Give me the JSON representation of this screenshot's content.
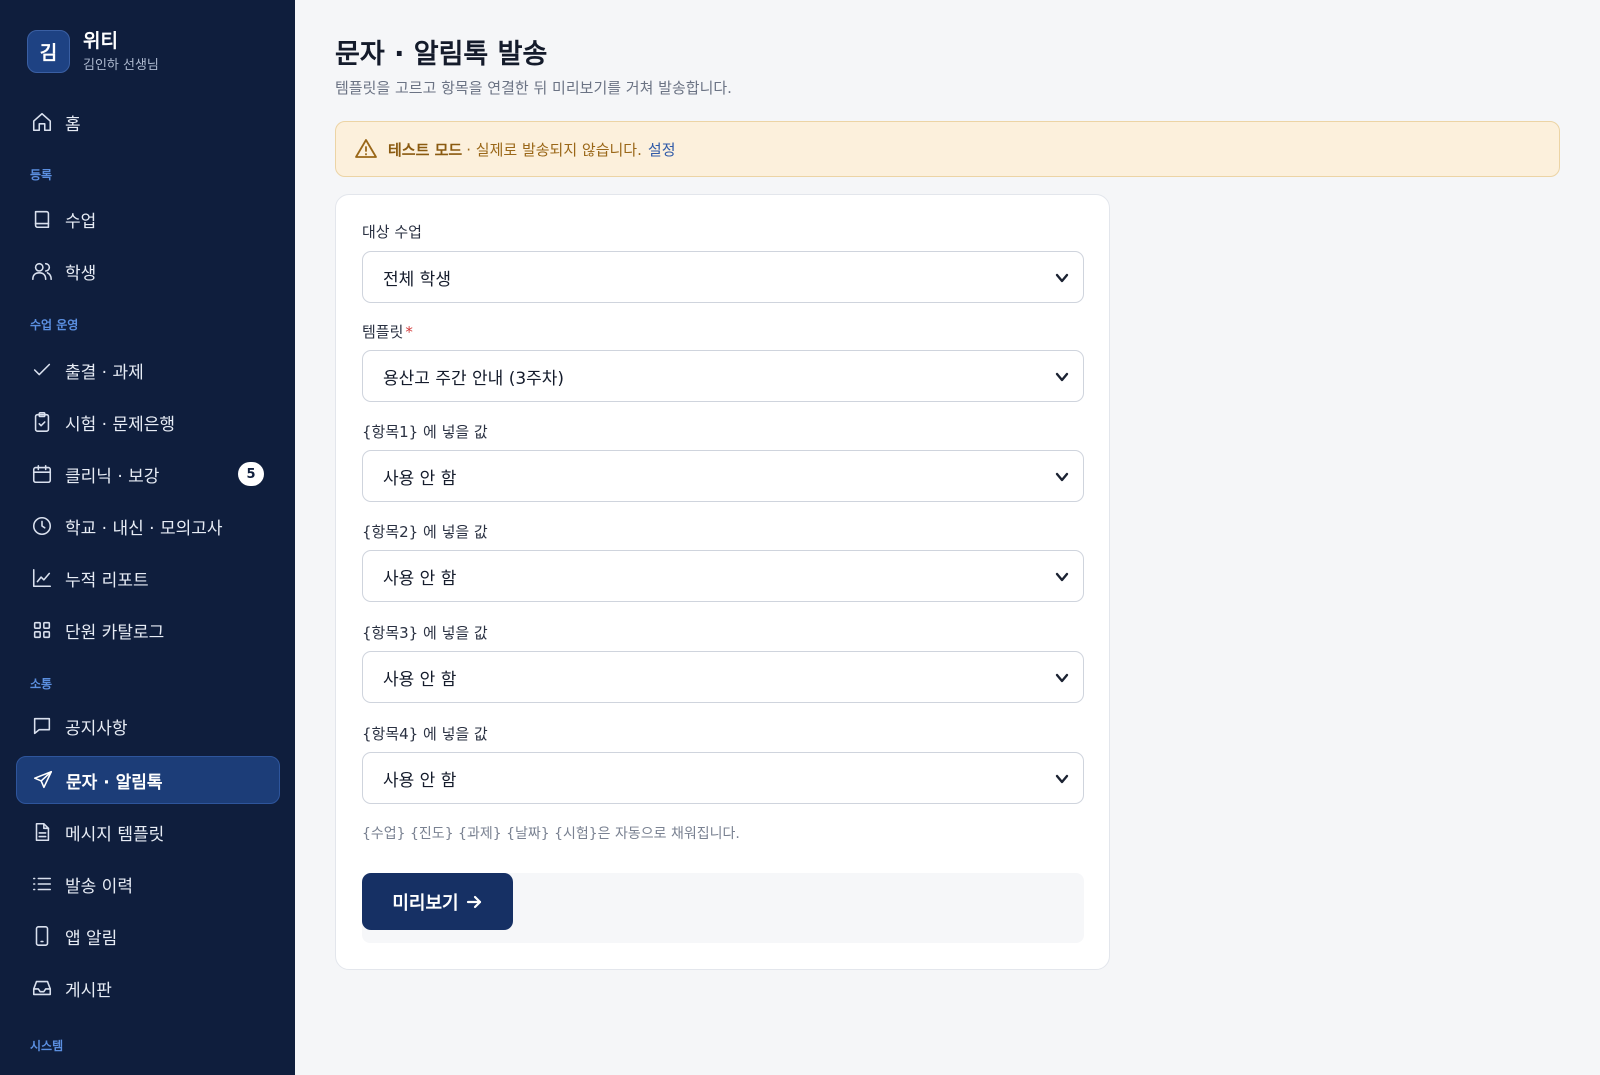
{
  "brand": {
    "avatar_letter": "김",
    "name": "위티",
    "user": "김인하 선생님"
  },
  "sidebar": {
    "home": {
      "label": "홈",
      "icon": "home-icon"
    },
    "sections": {
      "register": "등록",
      "operations": "수업 운영",
      "communication": "소통",
      "system": "시스템"
    },
    "register_items": [
      {
        "label": "수업",
        "icon": "book-icon"
      },
      {
        "label": "학생",
        "icon": "users-icon"
      }
    ],
    "operations_items": [
      {
        "label": "출결 · 과제",
        "icon": "check-icon"
      },
      {
        "label": "시험 · 문제은행",
        "icon": "clipboard-icon"
      },
      {
        "label": "클리닉 · 보강",
        "icon": "calendar-icon",
        "badge": "5"
      },
      {
        "label": "학교 · 내신 · 모의고사",
        "icon": "clock-icon"
      },
      {
        "label": "누적 리포트",
        "icon": "chart-line-icon"
      },
      {
        "label": "단원 카탈로그",
        "icon": "grid-icon"
      }
    ],
    "communication_items": [
      {
        "label": "공지사항",
        "icon": "message-icon"
      },
      {
        "label": "문자 · 알림톡",
        "icon": "send-icon",
        "active": true
      },
      {
        "label": "메시지 템플릿",
        "icon": "file-icon"
      },
      {
        "label": "발송 이력",
        "icon": "list-icon"
      },
      {
        "label": "앱 알림",
        "icon": "phone-icon"
      },
      {
        "label": "게시판",
        "icon": "inbox-icon"
      }
    ]
  },
  "page": {
    "title": "문자 · 알림톡 발송",
    "subtitle": "템플릿을 고르고 항목을 연결한 뒤 미리보기를 거쳐 발송합니다."
  },
  "alert": {
    "icon": "warning-icon",
    "strong": "테스트 모드",
    "text": "· 실제로 발송되지 않습니다.",
    "link": "설정",
    "colors": {
      "background": "#fcf0dc",
      "text": "#9a6718"
    }
  },
  "form": {
    "target_class": {
      "label": "대상 수업",
      "value": "전체 학생"
    },
    "template": {
      "label": "템플릿",
      "required_mark": "*",
      "value": "용산고 주간 안내 (3주차)"
    },
    "fields": [
      {
        "label": "{항목1} 에 넣을 값",
        "value": "사용 안 함"
      },
      {
        "label": "{항목2} 에 넣을 값",
        "value": "사용 안 함"
      },
      {
        "label": "{항목3} 에 넣을 값",
        "value": "사용 안 함"
      },
      {
        "label": "{항목4} 에 넣을 값",
        "value": "사용 안 함"
      }
    ],
    "hint": "{수업} {진도} {과제} {날짜} {시험}은 자동으로 채워집니다.",
    "preview_button": "미리보기"
  },
  "colors": {
    "sidebar": "#0f1e3d",
    "accent": "#163064",
    "active_item": "#1c3d78"
  }
}
